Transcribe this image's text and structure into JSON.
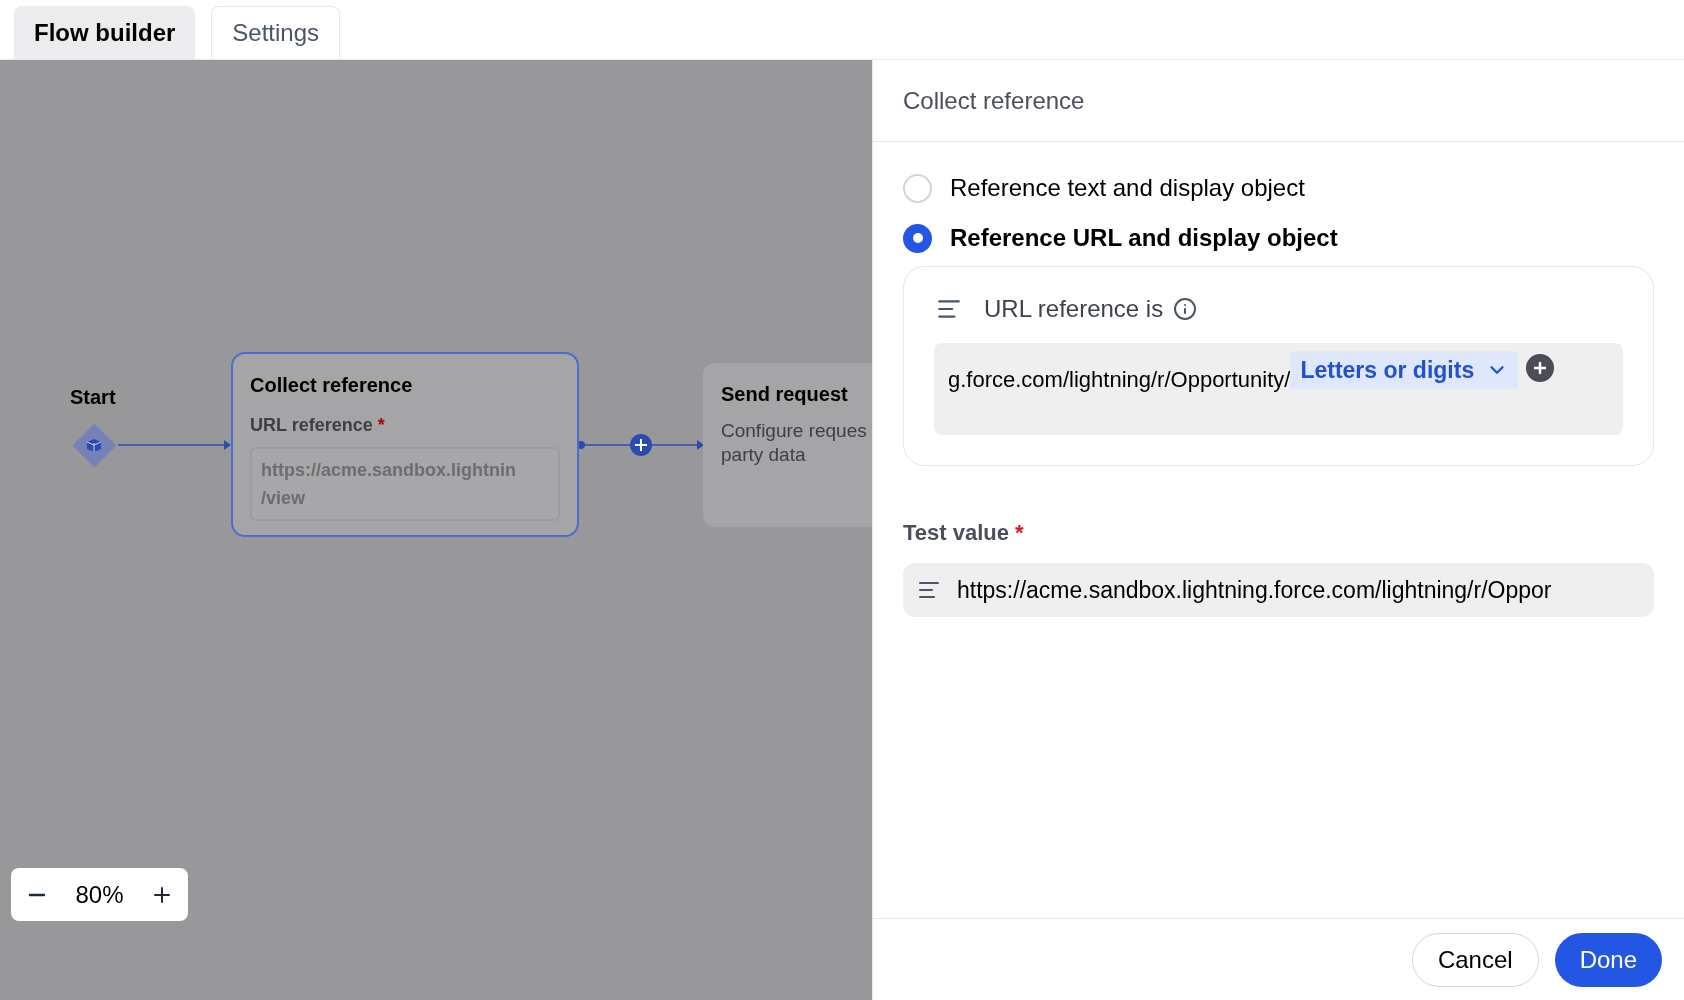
{
  "tabs": [
    {
      "label": "Flow builder",
      "selected": true
    },
    {
      "label": "Settings",
      "selected": false
    }
  ],
  "canvas": {
    "start_label": "Start",
    "nodes": [
      {
        "kind": "collect",
        "title": "Collect reference",
        "field_label": "URL reference",
        "required_mark": "*",
        "value_lines": [
          "https://acme.sandbox.lightnin",
          "/view"
        ],
        "selected": true
      },
      {
        "kind": "send",
        "title": "Send request",
        "description_lines": [
          "Configure reques",
          "party data"
        ],
        "selected": false
      }
    ],
    "zoom": "80%"
  },
  "panel": {
    "title": "Collect reference",
    "options": [
      {
        "label": "Reference text and display object",
        "selected": false
      },
      {
        "label": "Reference URL and display object",
        "selected": true
      }
    ],
    "reference": {
      "label": "URL reference is",
      "text": "g.force.com/lightning/r/Opportunity/",
      "token": "Letters or digits"
    },
    "test_value": {
      "label": "Test value",
      "required_mark": "*",
      "value": "https://acme.sandbox.lightning.force.com/lightning/r/Oppor"
    },
    "buttons": [
      {
        "label": "Cancel",
        "kind": "secondary"
      },
      {
        "label": "Done",
        "kind": "primary"
      }
    ]
  }
}
